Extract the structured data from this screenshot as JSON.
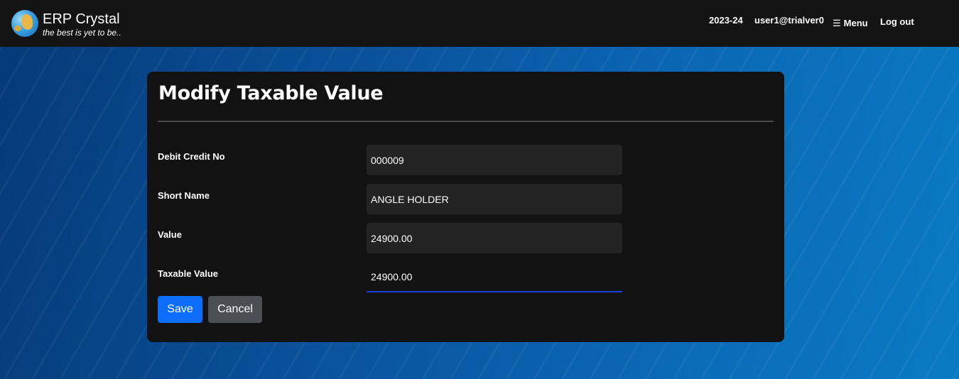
{
  "header": {
    "app_name": "ERP Crystal",
    "tagline": "the best is yet to be..",
    "year": "2023-24",
    "user": "user1@trialver0",
    "menu_label": "Menu",
    "logout_label": "Log out"
  },
  "form": {
    "title": "Modify Taxable Value",
    "fields": [
      {
        "label": "Debit Credit No",
        "value": "000009"
      },
      {
        "label": "Short Name",
        "value": "ANGLE HOLDER"
      },
      {
        "label": "Value",
        "value": "24900.00"
      },
      {
        "label": "Taxable Value",
        "value": "24900.00"
      }
    ],
    "save_label": "Save",
    "cancel_label": "Cancel"
  },
  "colors": {
    "save_button": "#0d6efd",
    "cancel_button": "#4b4f54",
    "active_underline": "#1a3fd6"
  }
}
